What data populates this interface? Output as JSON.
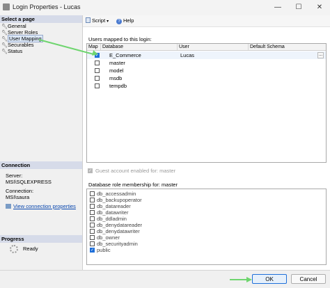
{
  "window": {
    "title": "Login Properties - Lucas",
    "minimize_glyph": "—",
    "maximize_glyph": "☐",
    "close_glyph": "✕"
  },
  "left_panel": {
    "select_page_header": "Select a page",
    "pages": [
      {
        "label": "General"
      },
      {
        "label": "Server Roles"
      },
      {
        "label": "User Mapping"
      },
      {
        "label": "Securables"
      },
      {
        "label": "Status"
      }
    ],
    "selected_page": "User Mapping",
    "connection_header": "Connection",
    "server_label": "Server:",
    "server_value": "MSI\\SQLEXPRESS",
    "connection_label": "Connection:",
    "connection_value": "MSI\\saura",
    "view_connection_link": "View connection properties",
    "progress_header": "Progress",
    "progress_status": "Ready"
  },
  "toolbar": {
    "script_label": "Script",
    "help_label": "Help"
  },
  "users_mapped": {
    "label": "Users mapped to this login:",
    "columns": [
      "Map",
      "Database",
      "User",
      "Default Schema"
    ],
    "rows": [
      {
        "map": true,
        "database": "E_Commerce",
        "user": "Lucas",
        "schema": ""
      },
      {
        "map": false,
        "database": "master",
        "user": "",
        "schema": ""
      },
      {
        "map": false,
        "database": "model",
        "user": "",
        "schema": ""
      },
      {
        "map": false,
        "database": "msdb",
        "user": "",
        "schema": ""
      },
      {
        "map": false,
        "database": "tempdb",
        "user": "",
        "schema": ""
      }
    ],
    "ellipsis_glyph": "..."
  },
  "guest_account": {
    "label": "Guest account enabled for: master",
    "checked": true,
    "enabled": false
  },
  "roles": {
    "label": "Database role membership for: master",
    "items": [
      {
        "name": "db_accessadmin",
        "checked": false
      },
      {
        "name": "db_backupoperator",
        "checked": false
      },
      {
        "name": "db_datareader",
        "checked": false
      },
      {
        "name": "db_datawriter",
        "checked": false
      },
      {
        "name": "db_ddladmin",
        "checked": false
      },
      {
        "name": "db_denydatareader",
        "checked": false
      },
      {
        "name": "db_denydatawriter",
        "checked": false
      },
      {
        "name": "db_owner",
        "checked": false
      },
      {
        "name": "db_securityadmin",
        "checked": false
      },
      {
        "name": "public",
        "checked": true
      }
    ]
  },
  "buttons": {
    "ok_label": "OK",
    "cancel_label": "Cancel"
  },
  "colors": {
    "accent": "#1e6fd9",
    "annotation_arrow": "#6fd56f"
  }
}
